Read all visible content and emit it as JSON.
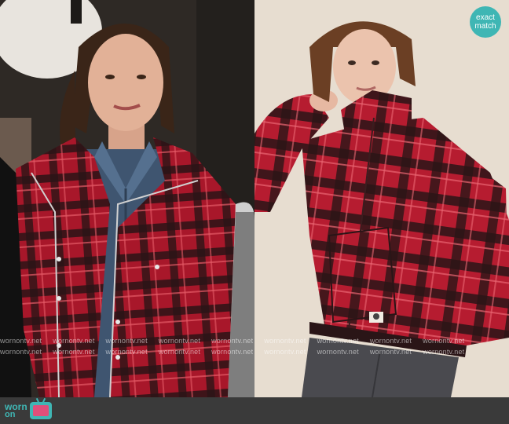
{
  "left_photo": {
    "icon": "person-plaid-jacket-photo"
  },
  "right_photo": {
    "icon": "model-plaid-jacket-photo"
  },
  "badge": {
    "line1": "exact",
    "line2": "match",
    "color": "#3fb6b4"
  },
  "watermark": {
    "text": "wornontv.net"
  },
  "footer": {
    "logo_line1": "worn",
    "logo_line2": "on",
    "logo_icon": "tv-icon",
    "bar_color": "#3a3a3a",
    "accent": "#3fb6b4"
  },
  "colors": {
    "plaid_red": "#b3192c",
    "plaid_dark": "#2b1416",
    "denim": "#3f5570",
    "backdrop_right": "#e7ddd0"
  }
}
